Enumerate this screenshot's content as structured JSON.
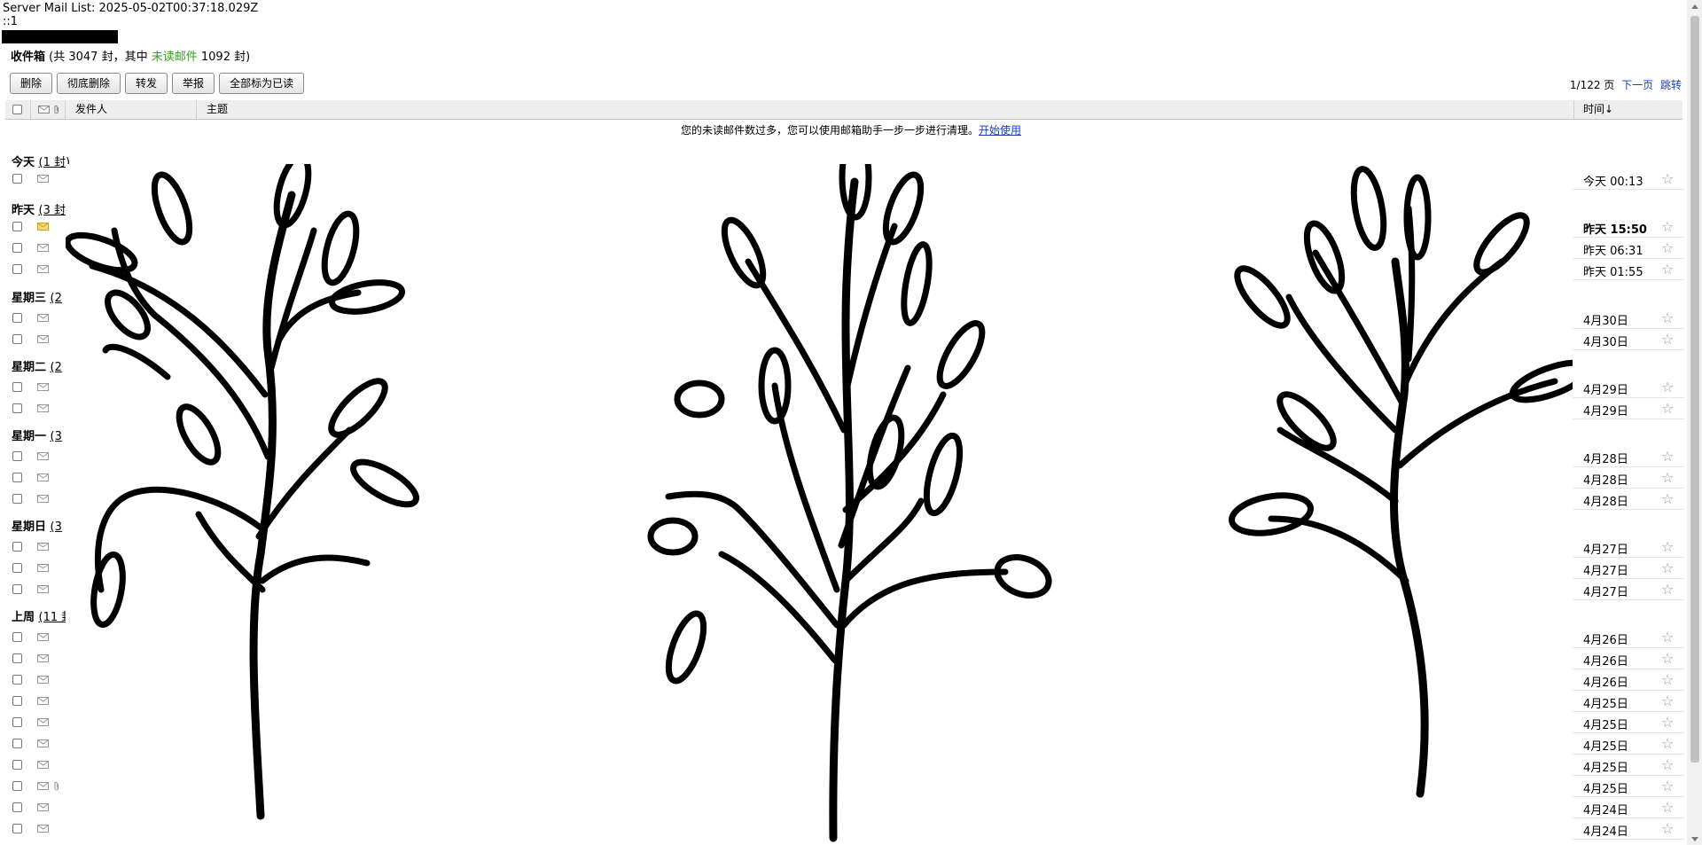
{
  "debug": {
    "line1": "Server Mail List: 2025-05-02T00:37:18.029Z",
    "line2": "::1"
  },
  "inbox": {
    "title": "收件箱",
    "summary_prefix": "(共 3047 封，其中",
    "unread_label": "未读邮件",
    "summary_suffix": "1092 封)",
    "unread_color": "#3a9d23"
  },
  "toolbar": {
    "delete": "删除",
    "delete_permanently": "彻底删除",
    "forward": "转发",
    "report": "举报",
    "mark_all_read": "全部标为已读"
  },
  "pager": {
    "page_info": "1/122 页",
    "next": "下一页",
    "jump": "跳转"
  },
  "columns": {
    "sender": "发件人",
    "subject": "主题",
    "time": "时间↓"
  },
  "tip": {
    "text": "您的未读邮件数过多，您可以使用邮箱助手一步一步进行清理。",
    "link": "开始使用"
  },
  "groups": [
    {
      "label": "今天",
      "count": "(1 封)"
    },
    {
      "label": "昨天",
      "count": "(3 封"
    },
    {
      "label": "星期三",
      "count": "(2"
    },
    {
      "label": "星期二",
      "count": "(2"
    },
    {
      "label": "星期一",
      "count": "(3"
    },
    {
      "label": "星期日",
      "count": "(3"
    },
    {
      "label": "上周",
      "count": "(11 封"
    }
  ],
  "rows": [
    {
      "time": "今天 00:13",
      "unread": false,
      "bold": false
    },
    {
      "time": "昨天 15:50",
      "unread": true,
      "bold": true
    },
    {
      "time": "昨天 06:31",
      "unread": false,
      "bold": false
    },
    {
      "time": "昨天 01:55",
      "unread": false,
      "bold": false
    },
    {
      "time": "4月30日",
      "unread": false,
      "bold": false
    },
    {
      "time": "4月30日",
      "unread": false,
      "bold": false
    },
    {
      "time": "4月29日",
      "unread": false,
      "bold": false
    },
    {
      "time": "4月29日",
      "unread": false,
      "bold": false
    },
    {
      "time": "4月28日",
      "unread": false,
      "bold": false
    },
    {
      "time": "4月28日",
      "unread": false,
      "bold": false
    },
    {
      "time": "4月28日",
      "unread": false,
      "bold": false
    },
    {
      "time": "4月27日",
      "unread": false,
      "bold": false
    },
    {
      "time": "4月27日",
      "unread": false,
      "bold": false
    },
    {
      "time": "4月27日",
      "unread": false,
      "bold": false
    },
    {
      "time": "4月26日",
      "unread": false,
      "bold": false
    },
    {
      "time": "4月26日",
      "unread": false,
      "bold": false
    },
    {
      "time": "4月26日",
      "unread": false,
      "bold": false
    },
    {
      "time": "4月25日",
      "unread": false,
      "bold": false
    },
    {
      "time": "4月25日",
      "unread": false,
      "bold": false
    },
    {
      "time": "4月25日",
      "unread": false,
      "bold": false
    },
    {
      "time": "4月25日",
      "unread": false,
      "bold": false
    },
    {
      "time": "4月25日",
      "unread": false,
      "bold": false,
      "attachment": true
    },
    {
      "time": "4月24日",
      "unread": false,
      "bold": false
    },
    {
      "time": "4月24日",
      "unread": false,
      "bold": false
    }
  ],
  "star_glyph": "☆"
}
